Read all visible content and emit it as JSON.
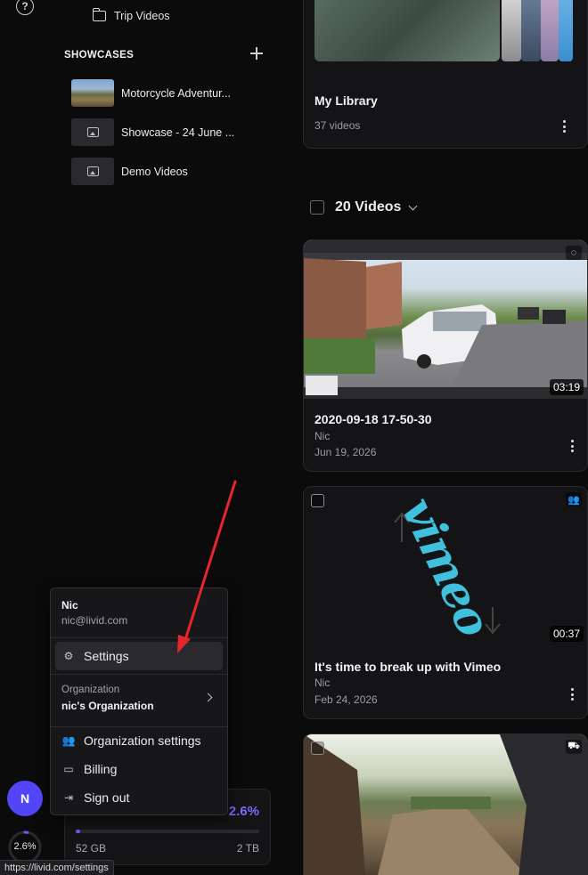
{
  "sidebar": {
    "folder_item": "Trip Videos",
    "showcases_title": "SHOWCASES",
    "showcases": [
      {
        "label": "Motorcycle Adventur..."
      },
      {
        "label": "Showcase - 24 June ..."
      },
      {
        "label": "Demo Videos"
      }
    ]
  },
  "library": {
    "title": "My Library",
    "count": "37 videos"
  },
  "videos_header": {
    "label": "20 Videos"
  },
  "videos": [
    {
      "title": "2020-09-18 17-50-30",
      "author": "Nic",
      "date": "Jun 19, 2026",
      "duration": "03:19"
    },
    {
      "title": "It's time to break up with Vimeo",
      "author": "Nic",
      "date": "Feb 24, 2026",
      "duration": "00:37",
      "thumb_text": "vimeo"
    },
    {
      "title": "",
      "author": "",
      "date": "",
      "duration": ""
    }
  ],
  "account_menu": {
    "name": "Nic",
    "email": "nic@livid.com",
    "settings": "Settings",
    "org_label": "Organization",
    "org_name": "nic's Organization",
    "org_settings": "Organization settings",
    "billing": "Billing",
    "sign_out": "Sign out"
  },
  "storage": {
    "percent_label": "2.6%",
    "percent_value": 2.6,
    "used": "52 GB",
    "total": "2 TB"
  },
  "user": {
    "initial": "N",
    "ring_label": "2.6%"
  },
  "status_bar": {
    "url": "https://livid.com/settings"
  },
  "colors": {
    "accent": "#6c5cff",
    "avatar": "#5145f5",
    "annotation_arrow": "#e5262a"
  }
}
